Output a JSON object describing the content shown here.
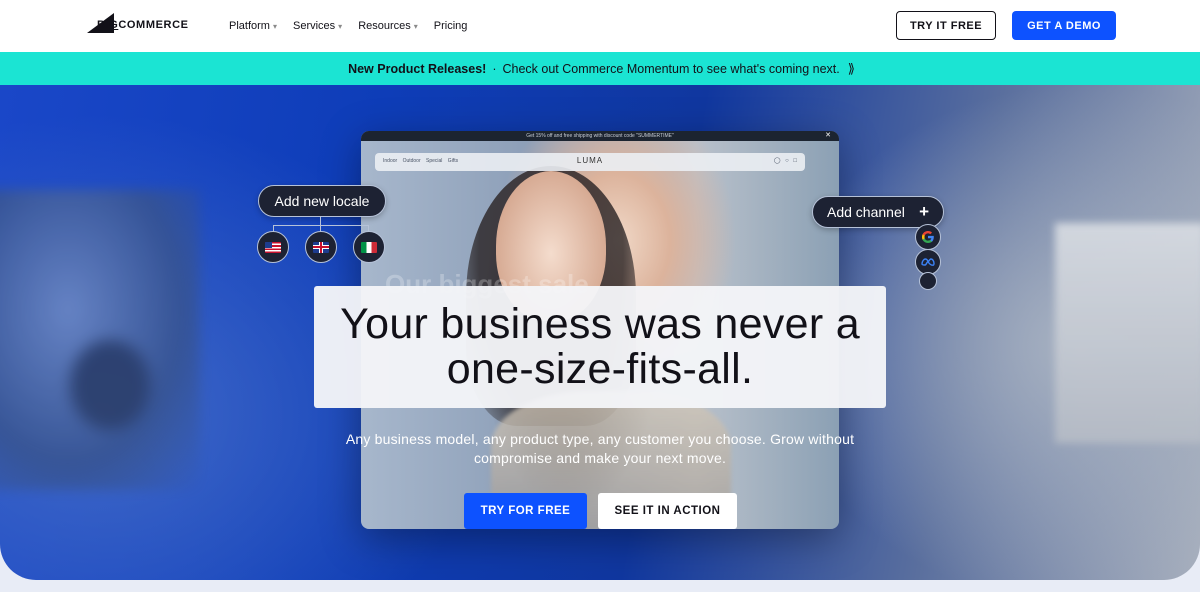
{
  "nav": {
    "logo": {
      "big": "BIG",
      "rest": "COMMERCE"
    },
    "links": [
      {
        "label": "Platform",
        "has_dropdown": true
      },
      {
        "label": "Services",
        "has_dropdown": true
      },
      {
        "label": "Resources",
        "has_dropdown": true
      },
      {
        "label": "Pricing",
        "has_dropdown": false
      }
    ],
    "try_label": "TRY IT FREE",
    "demo_label": "GET A DEMO"
  },
  "banner": {
    "bold": "New Product Releases!",
    "separator": "·",
    "text": "Check out Commerce Momentum to see what's coming next.",
    "icon": "double-chevron-right-icon"
  },
  "hero": {
    "mockup": {
      "promo": "Get 15% off and free shipping with discount code \"SUMMERTIME\"",
      "menu": "Indoor Outdoor Special Gifts",
      "brand": "LUMA",
      "ghost_text": "Our biggest sale"
    },
    "locale": {
      "label": "Add new locale",
      "flags": [
        "us-flag-icon",
        "uk-flag-icon",
        "italy-flag-icon"
      ]
    },
    "channel": {
      "label": "Add channel",
      "plus": "+",
      "icons": [
        "google-icon",
        "meta-icon",
        "channel-icon"
      ]
    },
    "headline_line1": "Your business was never a",
    "headline_line2": "one-size-fits-all.",
    "subheadline": "Any business model, any product type, any customer you choose. Grow without compromise and make your next move.",
    "cta_primary": "TRY FOR FREE",
    "cta_secondary": "SEE IT IN ACTION"
  },
  "colors": {
    "accent": "#0d52ff",
    "banner": "#1be4d3",
    "dark": "#121118",
    "pill": "#1d2233"
  }
}
